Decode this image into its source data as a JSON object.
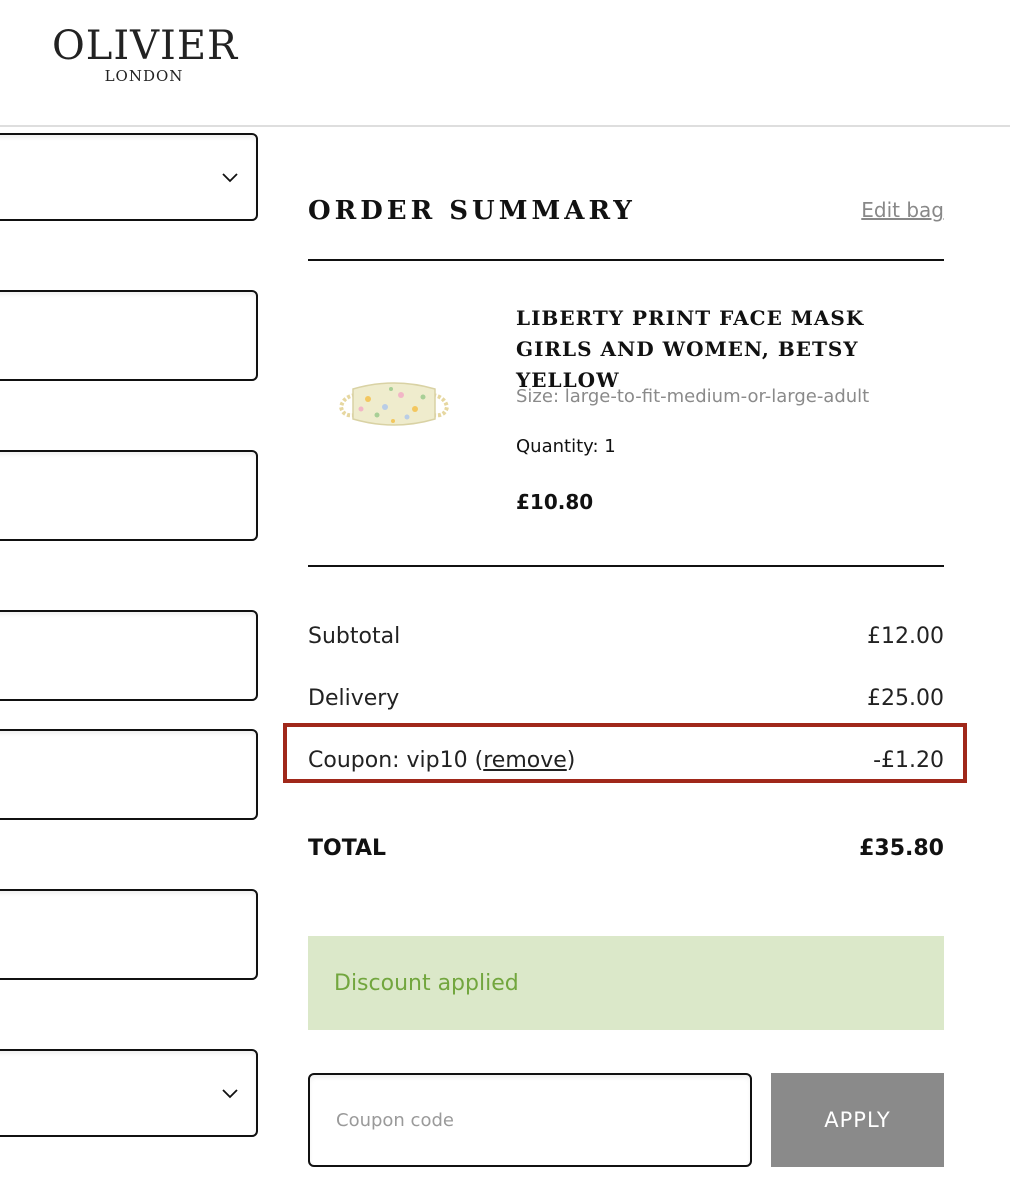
{
  "brand": {
    "name": "OLIVIER",
    "sub": "LONDON"
  },
  "summary": {
    "title": "ORDER SUMMARY",
    "edit_label": "Edit bag"
  },
  "product": {
    "name": "Liberty Print Face Mask Girls and Women, Betsy Yellow",
    "size_text": "Size: large-to-fit-medium-or-large-adult",
    "quantity_text": "Quantity: 1",
    "price": "£10.80"
  },
  "totals": {
    "subtotal_label": "Subtotal",
    "subtotal_value": "£12.00",
    "delivery_label": "Delivery",
    "delivery_value": "£25.00",
    "coupon_prefix": "Coupon: vip10 (",
    "coupon_remove": "remove",
    "coupon_suffix": ")",
    "coupon_value": "-£1.20",
    "total_label": "TOTAL",
    "total_value": "£35.80"
  },
  "message": "Discount applied",
  "coupon_form": {
    "placeholder": "Coupon code",
    "apply_label": "APPLY"
  },
  "colors": {
    "highlight": "#a0281a",
    "message_bg": "#dbe8c9",
    "message_text": "#72a63e",
    "apply_bg": "#8a8a8a"
  }
}
